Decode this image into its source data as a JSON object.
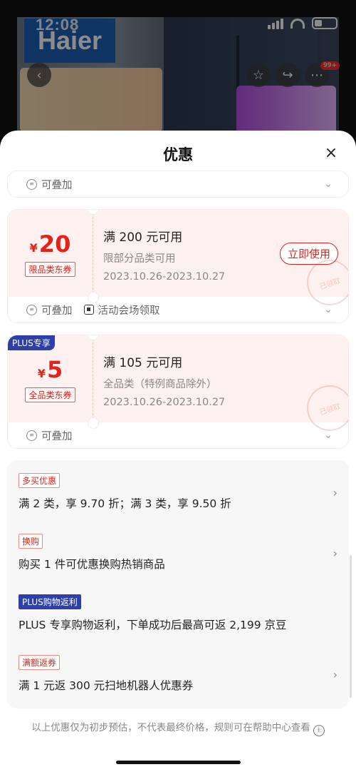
{
  "status_bar": {
    "time": "12:08"
  },
  "background": {
    "brand": "Haier",
    "badge_count": "99+"
  },
  "sheet": {
    "title": "优惠",
    "close_label": "×",
    "partial_coupon": {
      "stack_label": "可叠加"
    },
    "coupons": [
      {
        "currency": "¥",
        "amount": "20",
        "type_label": "限品类东券",
        "condition": "满 200 元可用",
        "scope": "限部分品类可用",
        "date_range": "2023.10.26-2023.10.27",
        "action_label": "立即使用",
        "stamp_text": "已领取",
        "stack_label": "可叠加",
        "source_label": "活动会场领取"
      },
      {
        "plus_tag": "PLUS专享",
        "currency": "¥",
        "amount": "5",
        "type_label": "全品类东券",
        "condition": "满 105 元可用",
        "scope": "全品类（特例商品除外）",
        "date_range": "2023.10.26-2023.10.27",
        "stamp_text": "已领取",
        "stack_label": "可叠加"
      }
    ],
    "promotions": [
      {
        "tag": "多买优惠",
        "text": "满 2 类，享 9.70 折；满 3 类，享 9.50 折",
        "has_arrow": true
      },
      {
        "tag": "换购",
        "text": "购买 1 件可优惠换购热销商品",
        "has_arrow": true
      },
      {
        "tag": "PLUS购物返利",
        "text": "PLUS 专享购物返利，下单成功后最高可返 2,199 京豆",
        "has_arrow": false
      },
      {
        "tag": "满额返券",
        "text": "满 1 元返 300 元扫地机器人优惠券",
        "has_arrow": true
      }
    ],
    "disclaimer": "以上优惠仅为初步预估，不代表最终价格，规则可在帮助中心查看"
  },
  "colors": {
    "accent": "#e2231a",
    "plus": "#2e3fa8",
    "coupon_bg": "#fff1ef"
  }
}
